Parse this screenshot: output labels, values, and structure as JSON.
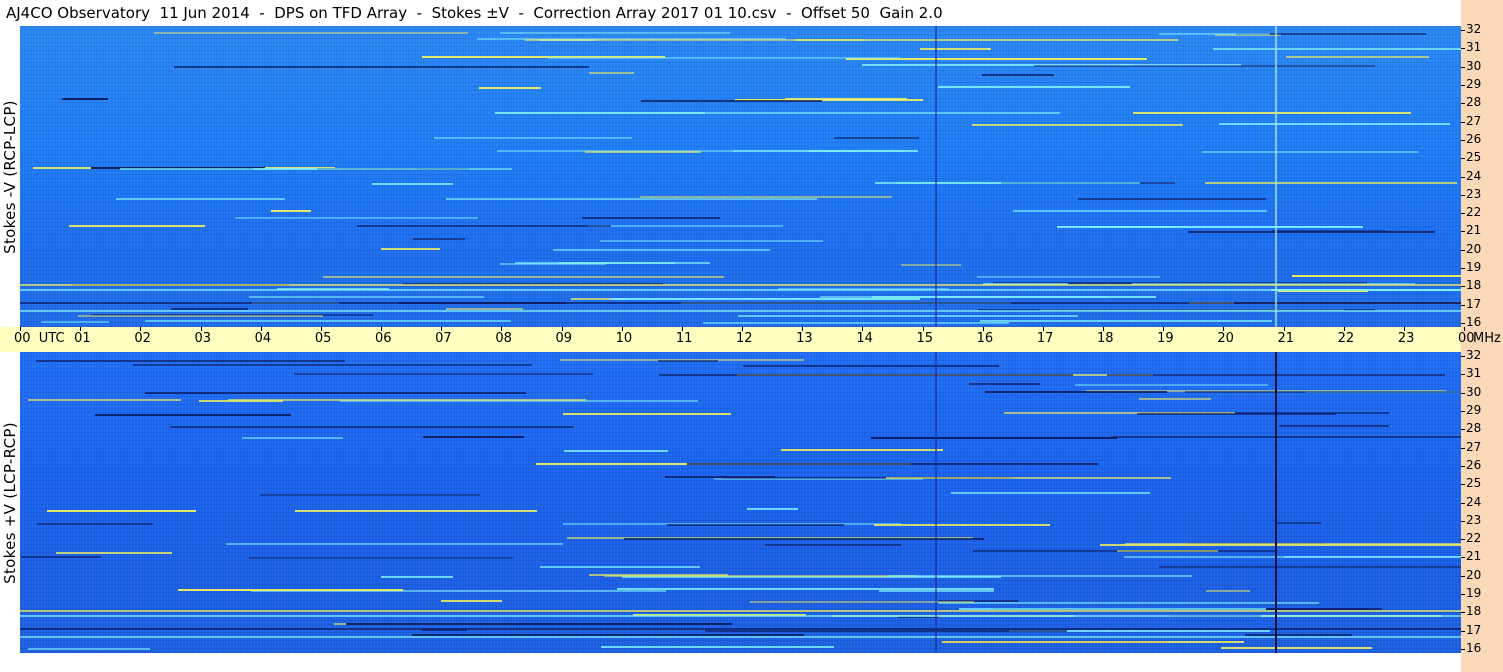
{
  "title": "AJ4CO Observatory  11 Jun 2014  -  DPS on TFD Array  -  Stokes ±V  -  Correction Array 2017 01 10.csv  -  Offset 50  Gain 2.0",
  "panels": {
    "top_label": "Stokes -V (RCP-LCP)",
    "bottom_label": "Stokes +V (LCP-RCP)"
  },
  "time_axis": {
    "labels": [
      "00  UTC",
      "01",
      "02",
      "03",
      "04",
      "05",
      "06",
      "07",
      "08",
      "09",
      "10",
      "11",
      "12",
      "13",
      "14",
      "15",
      "16",
      "17",
      "18",
      "19",
      "20",
      "21",
      "22",
      "23",
      "00"
    ],
    "unit": "MHz"
  },
  "freq_axis": {
    "labels": [
      "32",
      "31",
      "30",
      "29",
      "28",
      "27",
      "26",
      "25",
      "24",
      "23",
      "22",
      "21",
      "20",
      "19",
      "18",
      "17",
      "16"
    ]
  },
  "colors": {
    "panel_blue": "#1f7cf0",
    "axis_bg": "#ffffc0",
    "right_strip": "#fad9b8",
    "streak_cyan": "#7ff0ff",
    "streak_yellow": "#f0f060",
    "streak_dark": "#0a1a60"
  }
}
